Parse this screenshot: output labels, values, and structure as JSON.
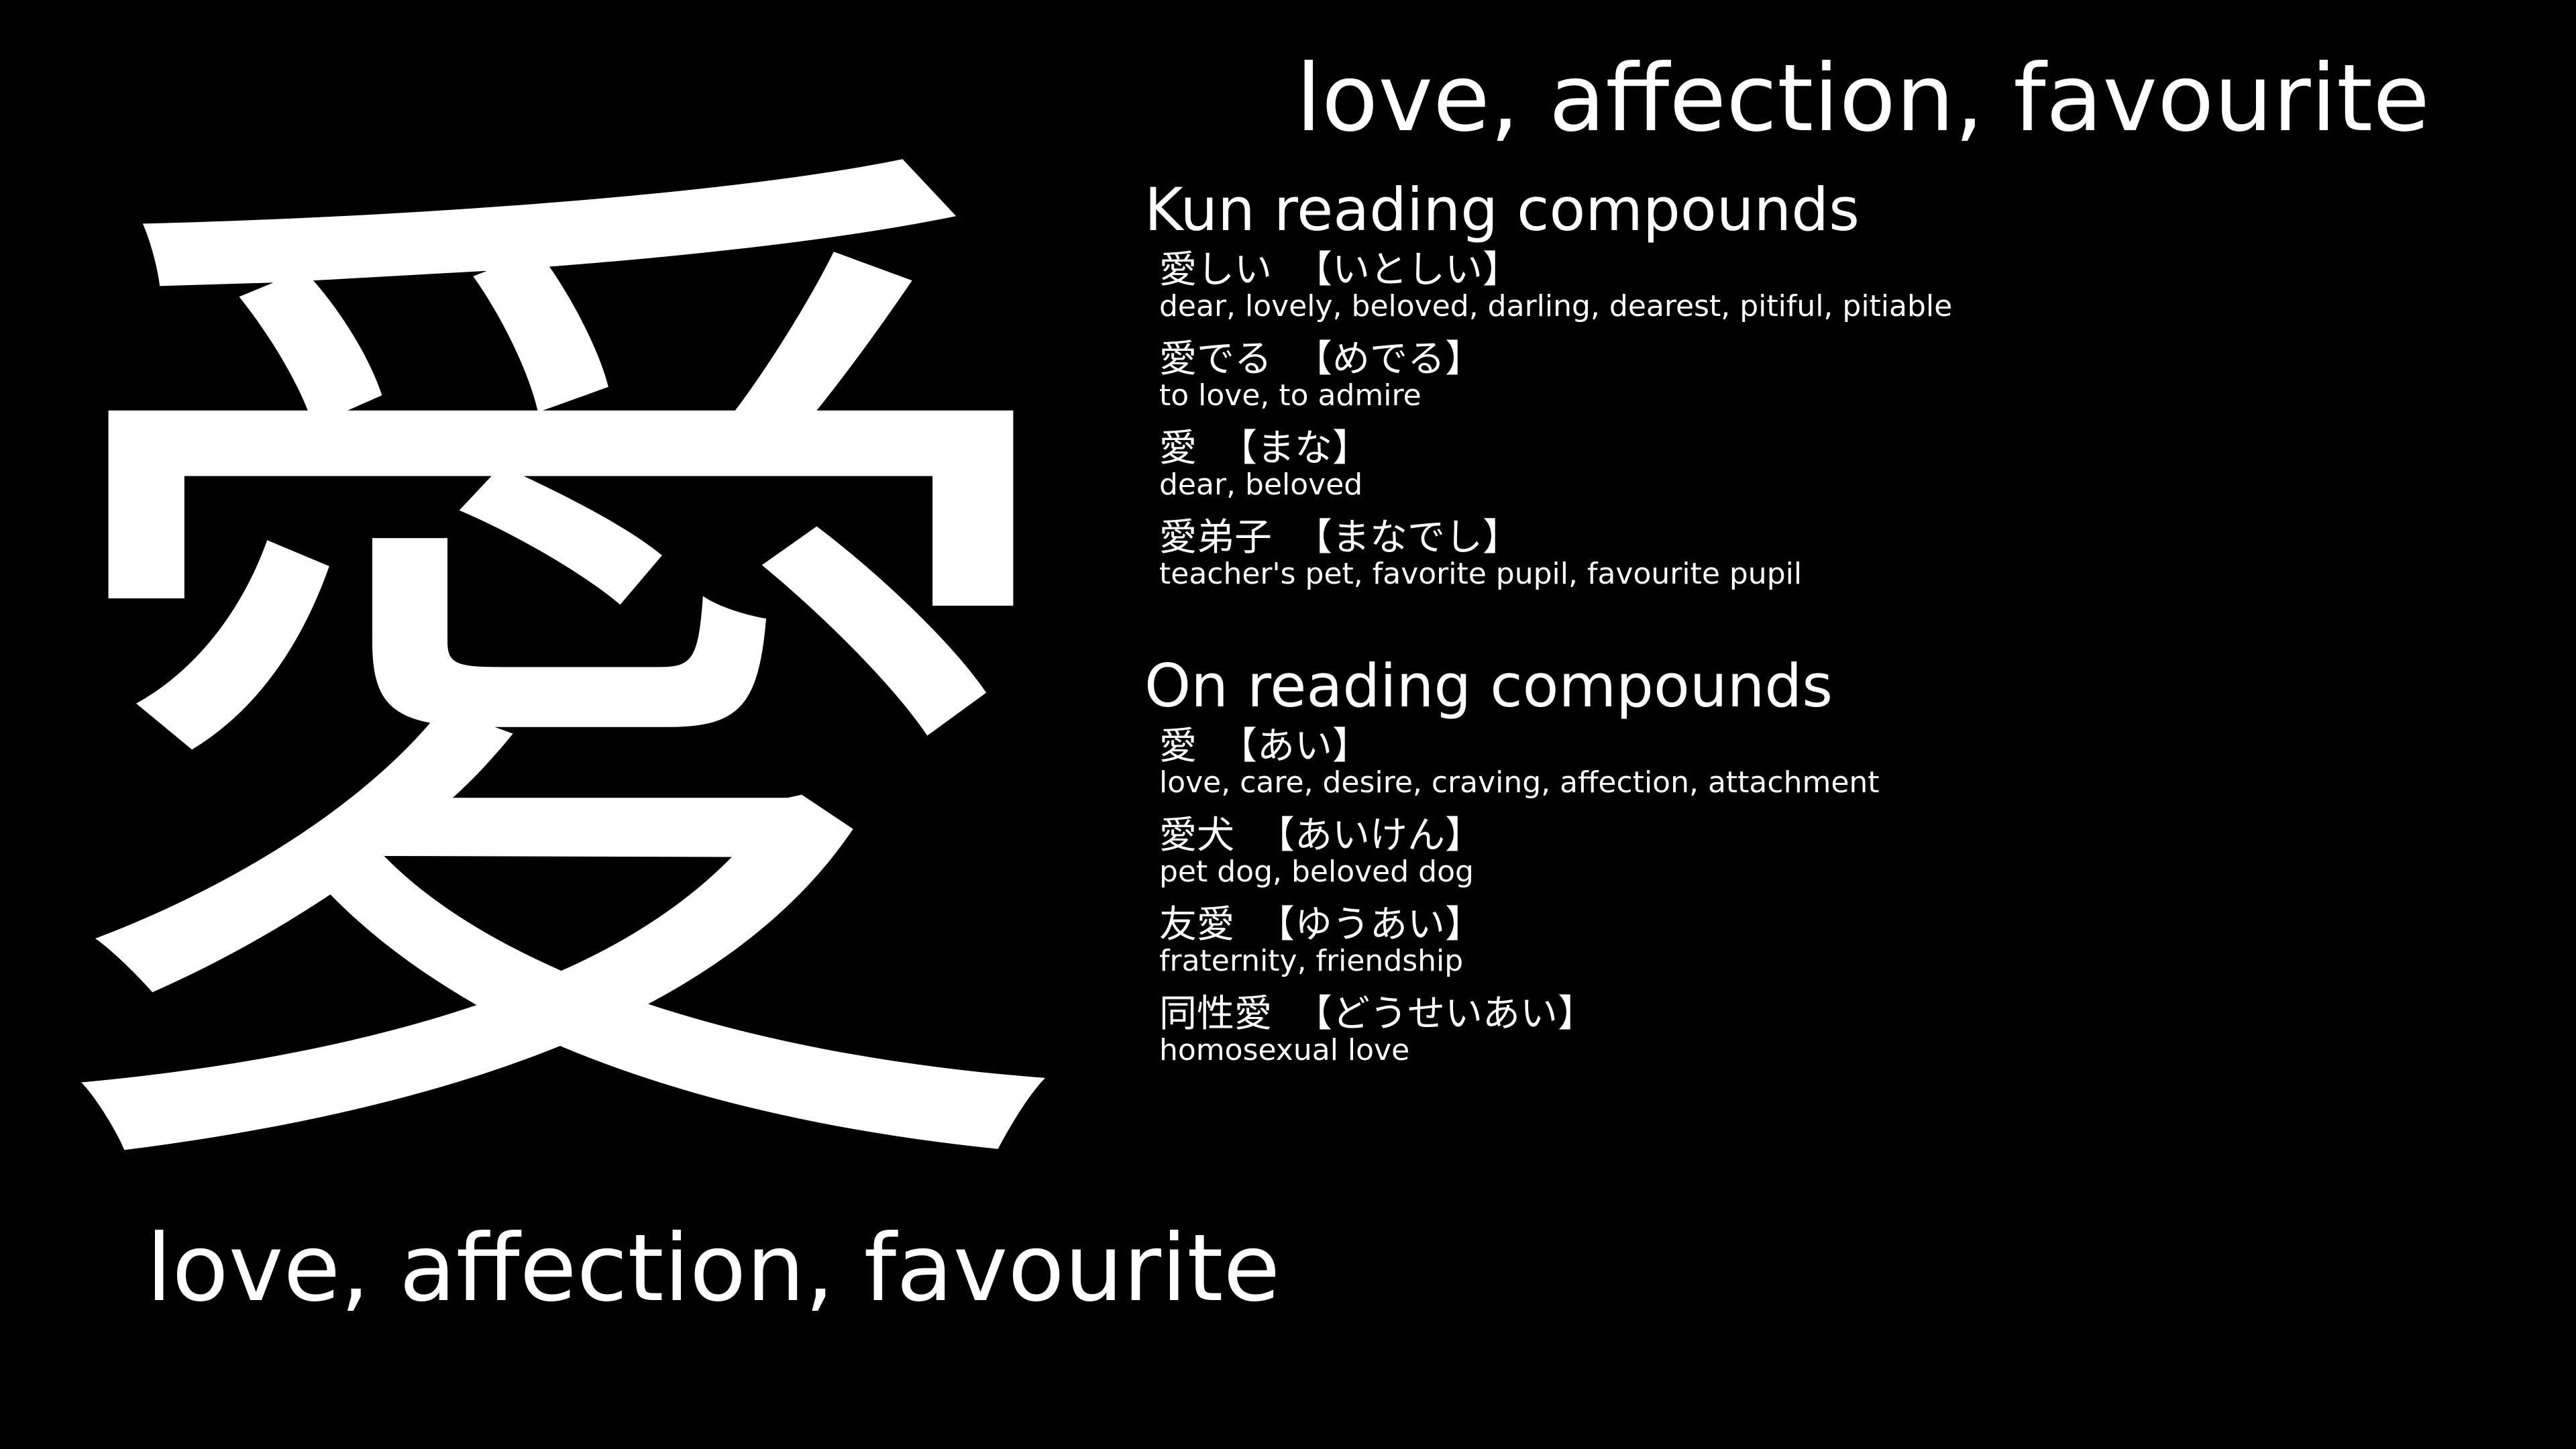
{
  "kanji": {
    "character": "愛",
    "meaning": "love, affection, favourite"
  },
  "header": {
    "meaning": "love, affection, favourite"
  },
  "kun": {
    "title": "Kun reading compounds",
    "compounds": [
      {
        "word": "愛しい",
        "reading": "【いとしい】",
        "meaning": "dear, lovely, beloved, darling, dearest, pitiful, pitiable"
      },
      {
        "word": "愛でる",
        "reading": "【めでる】",
        "meaning": "to love, to admire"
      },
      {
        "word": "愛",
        "reading": "【まな】",
        "meaning": "dear, beloved"
      },
      {
        "word": "愛弟子",
        "reading": "【まなでし】",
        "meaning": "teacher's pet, favorite pupil, favourite pupil"
      }
    ]
  },
  "on": {
    "title": "On reading compounds",
    "compounds": [
      {
        "word": "愛",
        "reading": "【あい】",
        "meaning": "love, care, desire, craving, affection, attachment"
      },
      {
        "word": "愛犬",
        "reading": "【あいけん】",
        "meaning": "pet dog, beloved dog"
      },
      {
        "word": "友愛",
        "reading": "【ゆうあい】",
        "meaning": "fraternity, friendship"
      },
      {
        "word": "同性愛",
        "reading": "【どうせいあい】",
        "meaning": "homosexual love"
      }
    ]
  },
  "colors": {
    "background": "#000000",
    "text": "#ffffff"
  }
}
